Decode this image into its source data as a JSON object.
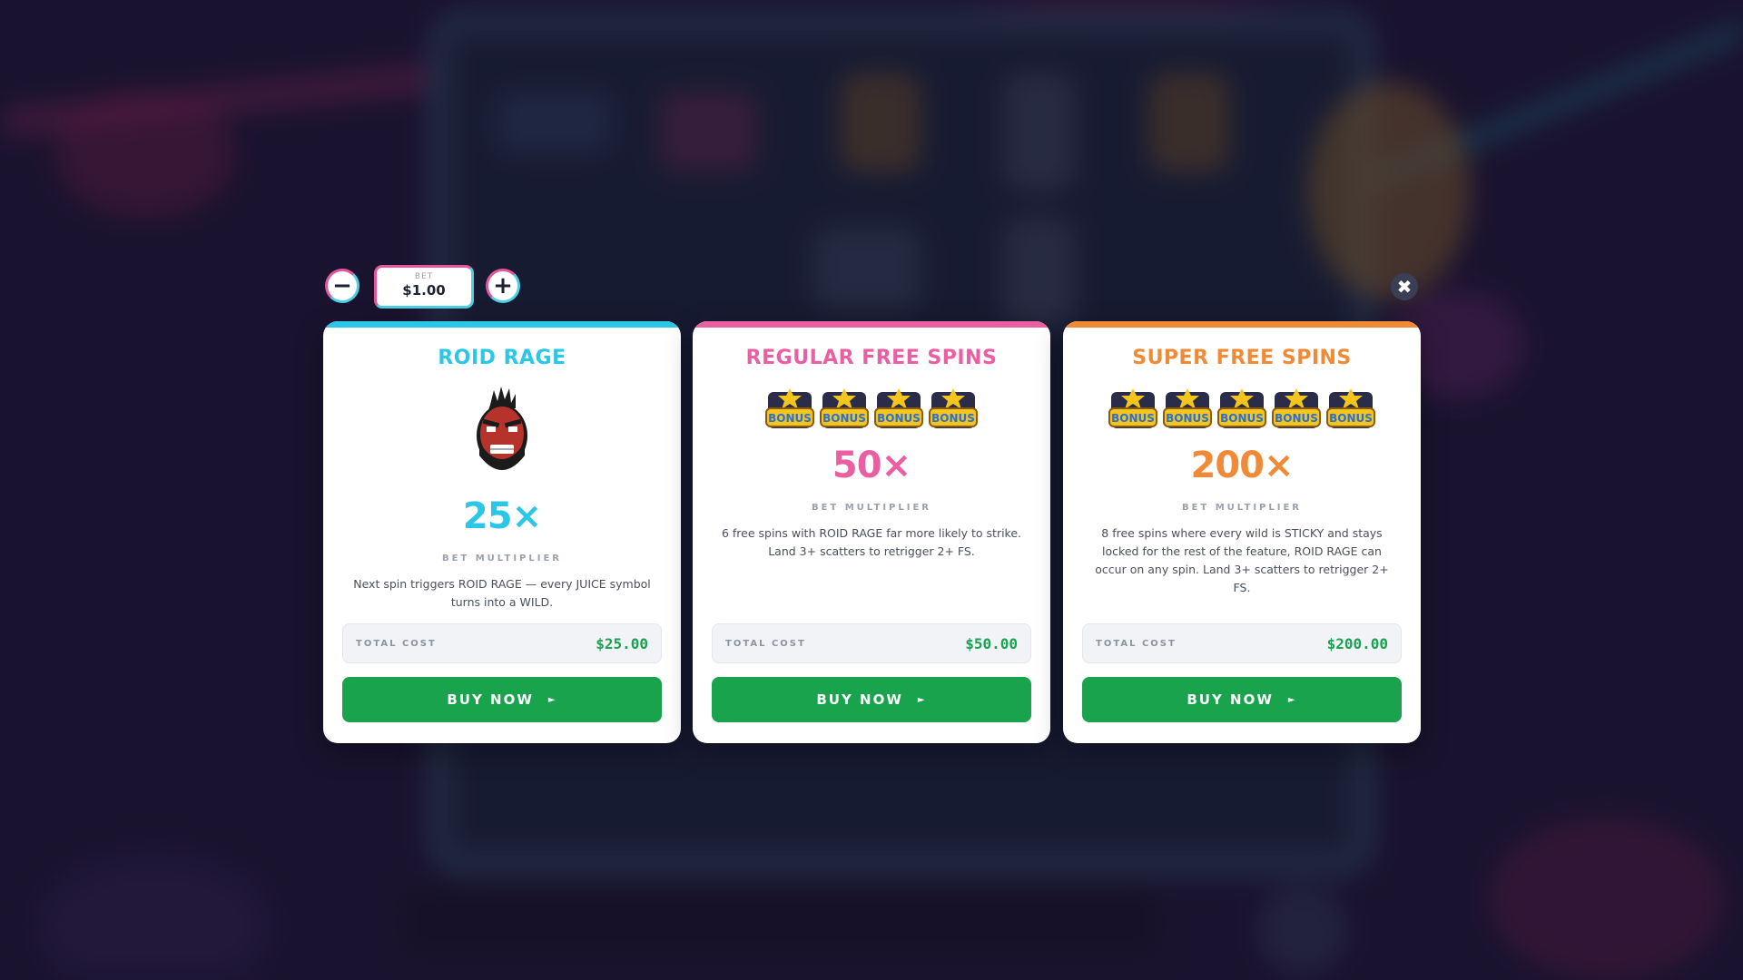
{
  "bet": {
    "minus_symbol": "−",
    "plus_symbol": "+",
    "label": "BET",
    "value": "$1.00"
  },
  "close_symbol": "✖",
  "cards": [
    {
      "title": "ROID RAGE",
      "accent": "#2cc7e6",
      "multiplier": "25×",
      "multiplier_label": "BET MULTIPLIER",
      "description": "Next spin triggers ROID RAGE — every JUICE symbol turns into a WILD.",
      "cost_label": "TOTAL COST",
      "cost_value": "$25.00",
      "buy_label": "BUY NOW",
      "buy_arrow": "►",
      "icon": "angry-face-icon"
    },
    {
      "title": "REGULAR FREE SPINS",
      "accent": "#ea5fa2",
      "multiplier": "50×",
      "multiplier_label": "BET MULTIPLIER",
      "description": "6 free spins with ROID RAGE far more likely to strike. Land 3+ scatters to retrigger 2+ FS.",
      "cost_label": "TOTAL COST",
      "cost_value": "$50.00",
      "buy_label": "BUY NOW",
      "buy_arrow": "►",
      "icon": "bonus-scatter-icon",
      "icon_count": 4,
      "icon_text": "BONUS"
    },
    {
      "title": "SUPER FREE SPINS",
      "accent": "#f08a37",
      "multiplier": "200×",
      "multiplier_label": "BET MULTIPLIER",
      "description": "8 free spins where every wild is STICKY and stays locked for the rest of the feature, ROID RAGE can occur on any spin. Land 3+ scatters to retrigger 2+ FS.",
      "cost_label": "TOTAL COST",
      "cost_value": "$200.00",
      "buy_label": "BUY NOW",
      "buy_arrow": "►",
      "icon": "bonus-scatter-icon",
      "icon_count": 5,
      "icon_text": "BONUS"
    }
  ],
  "button_color": "#1aa34d",
  "cost_color": "#1aa253"
}
